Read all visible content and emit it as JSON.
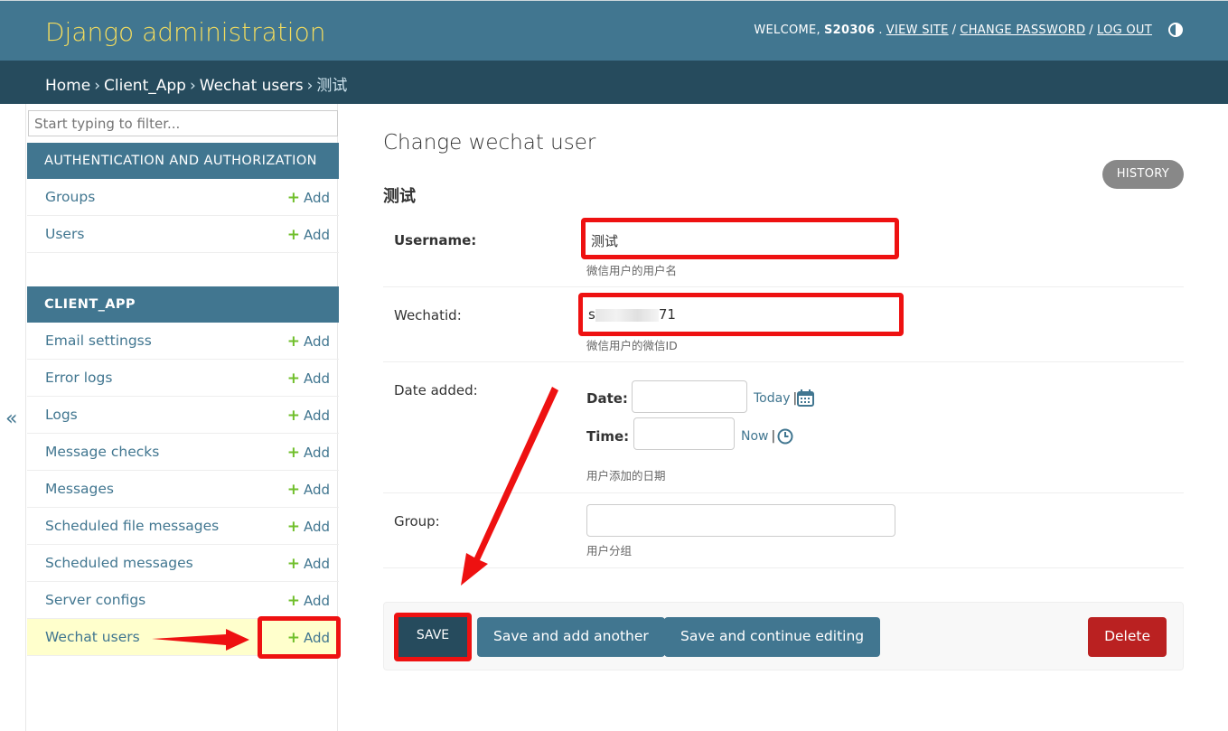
{
  "header": {
    "branding": "Django administration",
    "welcome_prefix": "WELCOME,",
    "username": "S20306",
    "view_site": "VIEW SITE",
    "change_password": "CHANGE PASSWORD",
    "log_out": "LOG OUT",
    "separator": "/"
  },
  "breadcrumbs": {
    "items": [
      "Home",
      "Client_App",
      "Wechat users",
      "测试"
    ],
    "separator": "›"
  },
  "sidebar": {
    "toggle": "«",
    "filter_placeholder": "Start typing to filter...",
    "add_label": "Add",
    "apps": [
      {
        "caption": "AUTHENTICATION AND AUTHORIZATION",
        "models": [
          "Groups",
          "Users"
        ]
      },
      {
        "caption": "CLIENT_APP",
        "models": [
          "Email settingss",
          "Error logs",
          "Logs",
          "Message checks",
          "Messages",
          "Scheduled file messages",
          "Scheduled messages",
          "Server configs",
          "Wechat users"
        ]
      }
    ],
    "current_model": "Wechat users"
  },
  "content": {
    "title": "Change wechat user",
    "history": "HISTORY",
    "object_title": "测试",
    "fields": {
      "username": {
        "label": "Username:",
        "value": "测试",
        "help": "微信用户的用户名"
      },
      "wechatid": {
        "label": "Wechatid:",
        "value_visible_start": "s",
        "value_visible_end": "71",
        "help": "微信用户的微信ID"
      },
      "date_added": {
        "label": "Date added:",
        "date_label": "Date:",
        "time_label": "Time:",
        "today": "Today",
        "now": "Now",
        "shortcut_sep": "|",
        "help": "用户添加的日期"
      },
      "group": {
        "label": "Group:",
        "help": "用户分组"
      }
    }
  },
  "submit": {
    "save": "SAVE",
    "save_add_another": "Save and add another",
    "save_continue": "Save and continue editing",
    "delete": "Delete"
  },
  "colors": {
    "primary": "#417690",
    "secondary": "#264b5d",
    "accent": "#f5dd5d",
    "delete": "#ba2121",
    "annotation": "#ee1111"
  }
}
